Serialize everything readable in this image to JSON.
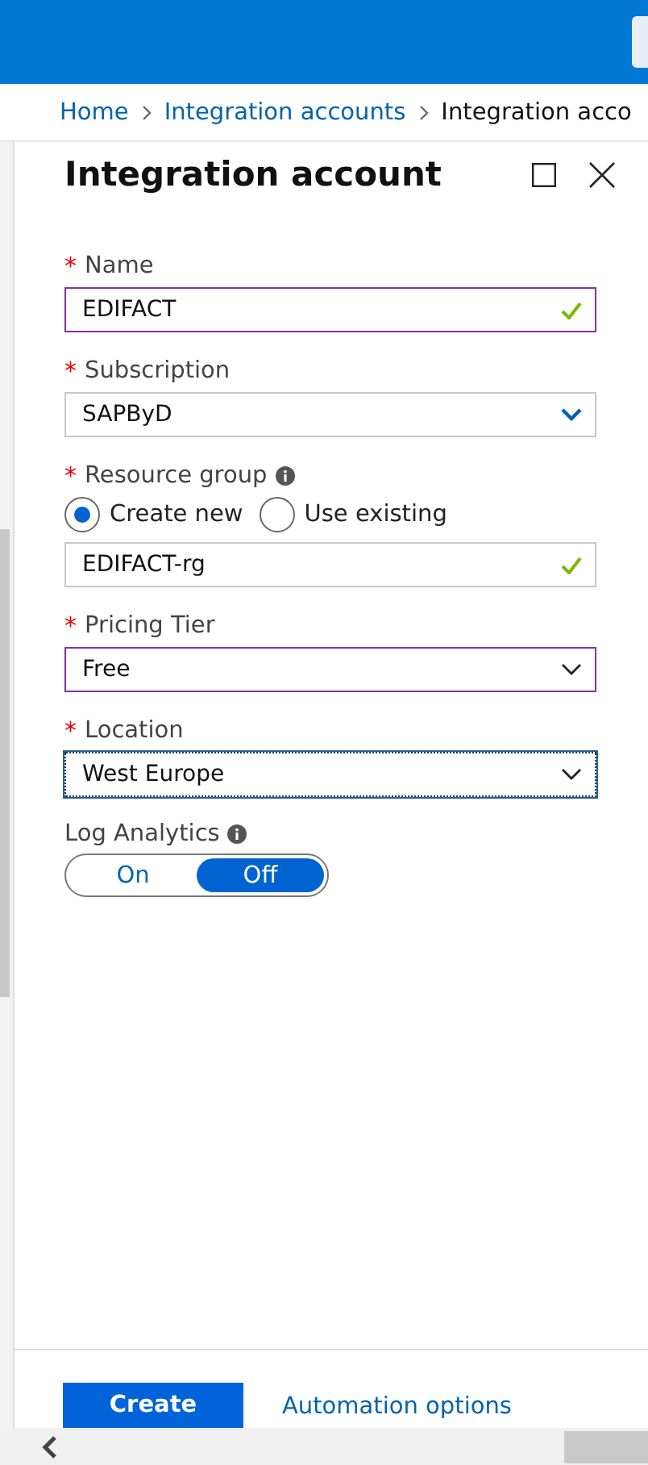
{
  "breadcrumb": [
    {
      "label": "Home",
      "kind": "link"
    },
    {
      "label": "Integration accounts",
      "kind": "link"
    },
    {
      "label": "Integration acco",
      "kind": "current"
    }
  ],
  "panel": {
    "title": "Integration account"
  },
  "fields": [
    {
      "kind": "text",
      "required_mark": "*",
      "label": "Name",
      "info": false,
      "value": "EDIFACT",
      "valid": true,
      "highlighted": true,
      "focused": false
    },
    {
      "kind": "dropdown",
      "required_mark": "*",
      "label": "Subscription",
      "info": false,
      "value": "SAPByD",
      "valid": false,
      "highlighted": false,
      "focused": false
    },
    {
      "kind": "radio-text",
      "required_mark": "*",
      "label": "Resource group",
      "info": true,
      "options": [
        {
          "label": "Create new",
          "selected": true
        },
        {
          "label": "Use existing",
          "selected": false
        }
      ],
      "input": {
        "value": "EDIFACT-rg",
        "valid": true,
        "highlighted": false,
        "focused": false
      }
    },
    {
      "kind": "dropdown",
      "required_mark": "*",
      "label": "Pricing Tier",
      "info": false,
      "value": "Free",
      "valid": false,
      "highlighted": true,
      "focused": false
    },
    {
      "kind": "dropdown",
      "required_mark": "*",
      "label": "Location",
      "info": false,
      "value": "West Europe",
      "valid": false,
      "highlighted": false,
      "focused": true
    },
    {
      "kind": "toggle",
      "label": "Log Analytics",
      "info": true,
      "options": [
        {
          "label": "On",
          "selected": false
        },
        {
          "label": "Off",
          "selected": true
        }
      ]
    }
  ],
  "footer": [
    {
      "label": "Create",
      "kind": "primary"
    },
    {
      "label": "Automation options",
      "kind": "link"
    }
  ]
}
